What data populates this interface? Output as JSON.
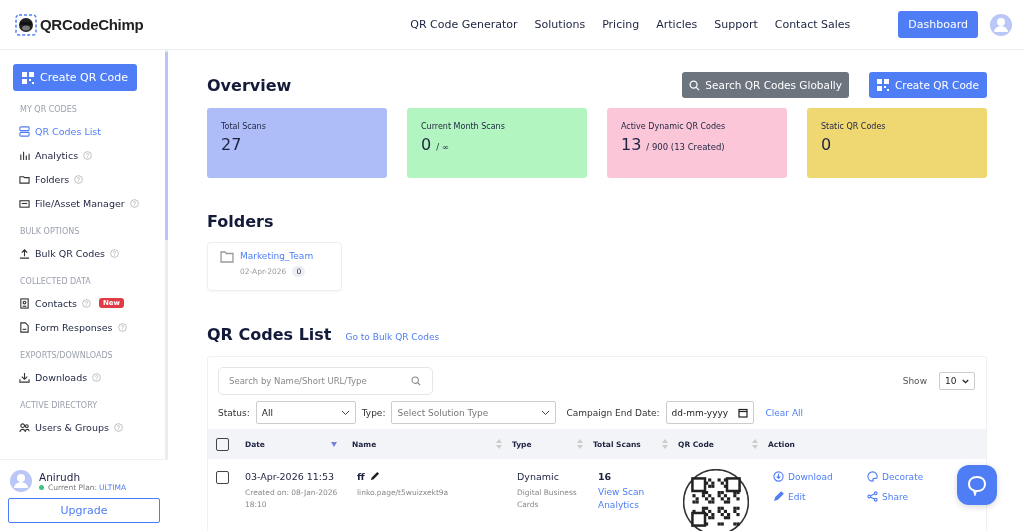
{
  "header": {
    "brand": "QRCodeChimp",
    "nav": [
      "QR Code Generator",
      "Solutions",
      "Pricing",
      "Articles",
      "Support",
      "Contact Sales"
    ],
    "dashboard_button": "Dashboard"
  },
  "sidebar": {
    "create_button": "Create QR Code",
    "sections": [
      {
        "title": "MY QR CODES",
        "items": [
          {
            "label": "QR Codes List",
            "kind": "list",
            "selected": true,
            "help": false
          },
          {
            "label": "Analytics",
            "kind": "chart",
            "selected": false,
            "help": true
          },
          {
            "label": "Folders",
            "kind": "folder",
            "selected": false,
            "help": true
          },
          {
            "label": "File/Asset Manager",
            "kind": "file",
            "selected": false,
            "help": true
          }
        ]
      },
      {
        "title": "BULK OPTIONS",
        "items": [
          {
            "label": "Bulk QR Codes",
            "kind": "upload",
            "selected": false,
            "help": true
          }
        ]
      },
      {
        "title": "COLLECTED DATA",
        "items": [
          {
            "label": "Contacts",
            "kind": "contact",
            "selected": false,
            "help": true,
            "badge": "New"
          },
          {
            "label": "Form Responses",
            "kind": "doc",
            "selected": false,
            "help": true
          }
        ]
      },
      {
        "title": "EXPORTS/DOWNLOADS",
        "items": [
          {
            "label": "Downloads",
            "kind": "download",
            "selected": false,
            "help": true
          }
        ]
      },
      {
        "title": "ACTIVE DIRECTORY",
        "items": [
          {
            "label": "Users & Groups",
            "kind": "users",
            "selected": false,
            "help": true
          }
        ]
      }
    ],
    "user": {
      "name": "Anirudh",
      "plan_label": "Current Plan:",
      "plan": "ULTIMA"
    },
    "upgrade_button": "Upgrade"
  },
  "overview": {
    "title": "Overview",
    "search_button": "Search QR Codes Globally",
    "create_button": "Create QR Code",
    "cards": [
      {
        "label": "Total Scans",
        "value": "27",
        "color": "#aebdf7"
      },
      {
        "label": "Current Month Scans",
        "value": "0",
        "suffix": "/ ∞",
        "color": "#b2f5c0"
      },
      {
        "label": "Active Dynamic QR Codes",
        "value": "13",
        "suffix": "/ 900 (13 Created)",
        "color": "#fbc6d8"
      },
      {
        "label": "Static QR Codes",
        "value": "0",
        "color": "#efd772"
      }
    ]
  },
  "folders": {
    "title": "Folders",
    "items": [
      {
        "name": "Marketing_Team",
        "date": "02-Apr-2026",
        "count": "0"
      }
    ]
  },
  "qr_list": {
    "title": "QR Codes List",
    "bulk_link": "Go to Bulk QR Codes",
    "search": {
      "placeholder": "Search by Name/Short URL/Type"
    },
    "show_label": "Show",
    "show_value": "10",
    "status_label": "Status:",
    "status_value": "All",
    "type_label": "Type:",
    "type_placeholder": "Select Solution Type",
    "date_label": "Campaign End Date:",
    "date_placeholder": "dd-mm-yyyy",
    "clear_all": "Clear All",
    "columns": [
      {
        "label": "Date",
        "sortable": true,
        "sorted": true
      },
      {
        "label": "Name",
        "sortable": true,
        "sorted": false
      },
      {
        "label": "Type",
        "sortable": true,
        "sorted": false
      },
      {
        "label": "Total Scans",
        "sortable": true,
        "sorted": false
      },
      {
        "label": "QR Code",
        "sortable": true,
        "sorted": false
      },
      {
        "label": "Action",
        "sortable": false
      }
    ],
    "all_checked": false,
    "rows": [
      {
        "checked": false,
        "date": "03-Apr-2026 11:53",
        "created": "Created on: 08-Jan-2026 18:10",
        "name": "ff",
        "url": "linko.page/t5wuizxekt9a",
        "type": "Dynamic",
        "subtype": "Digital Business Cards",
        "scans": "16",
        "scan_link": "View Scan Analytics",
        "actions": [
          {
            "label": "Download",
            "kind": "download"
          },
          {
            "label": "Decorate",
            "kind": "palette"
          },
          {
            "label": "Edit",
            "kind": "pencil"
          },
          {
            "label": "Share",
            "kind": "share"
          }
        ]
      }
    ]
  }
}
